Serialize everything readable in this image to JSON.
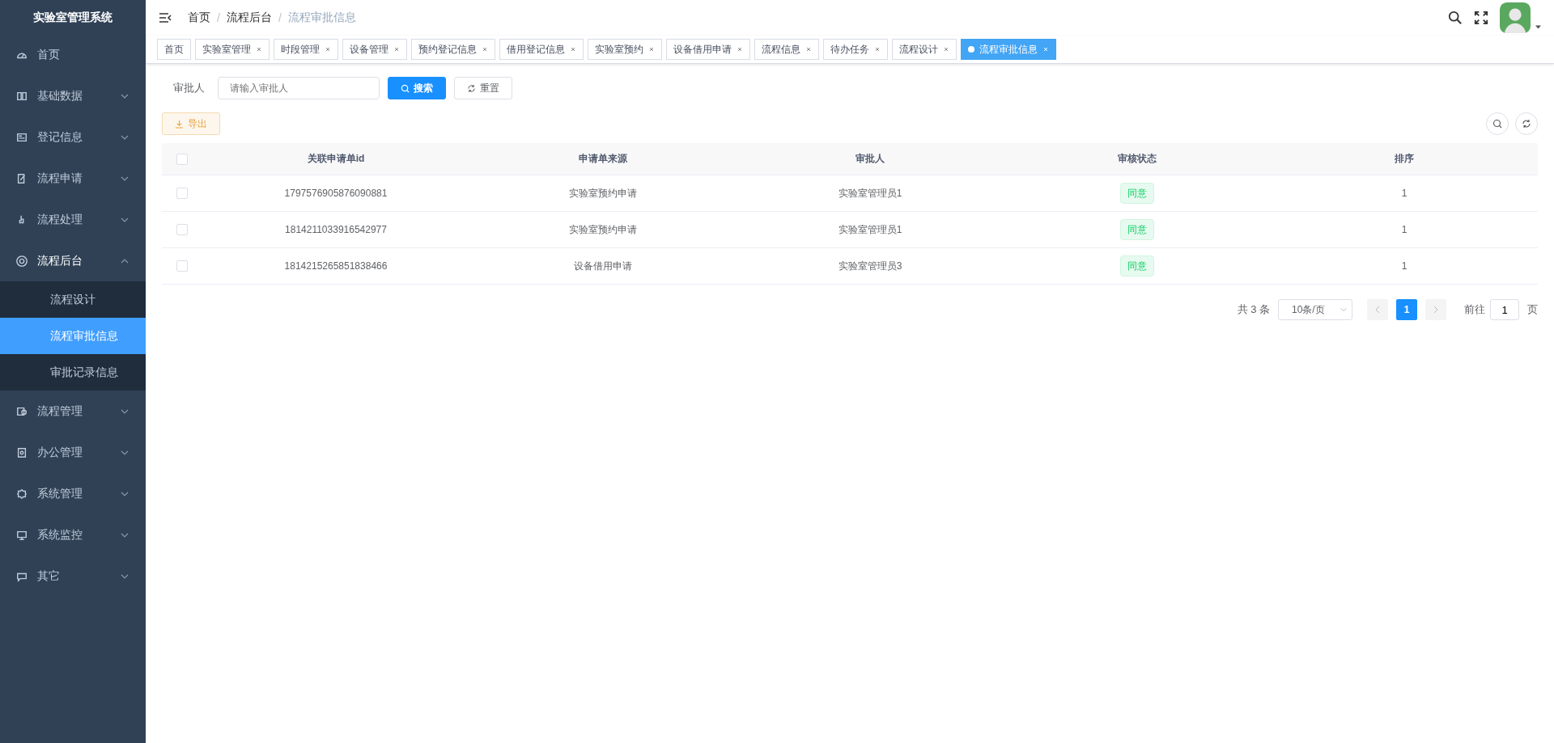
{
  "sidebar": {
    "title": "实验室管理系统",
    "items": [
      {
        "label": "首页"
      },
      {
        "label": "基础数据",
        "expanded": false
      },
      {
        "label": "登记信息",
        "expanded": false
      },
      {
        "label": "流程申请",
        "expanded": false
      },
      {
        "label": "流程处理",
        "expanded": false
      },
      {
        "label": "流程后台",
        "expanded": true,
        "children": [
          {
            "label": "流程设计",
            "selected": false
          },
          {
            "label": "流程审批信息",
            "selected": true
          },
          {
            "label": "审批记录信息",
            "selected": false
          }
        ]
      },
      {
        "label": "流程管理",
        "expanded": false
      },
      {
        "label": "办公管理",
        "expanded": false
      },
      {
        "label": "系统管理",
        "expanded": false
      },
      {
        "label": "系统监控",
        "expanded": false
      },
      {
        "label": "其它",
        "expanded": false
      }
    ]
  },
  "breadcrumb": [
    {
      "label": "首页",
      "current": false
    },
    {
      "separator": "/",
      "label": "流程后台",
      "current": false
    },
    {
      "separator": "/",
      "label": "流程审批信息",
      "current": true
    }
  ],
  "tags": [
    {
      "label": "首页",
      "selected": false,
      "closable": false
    },
    {
      "label": "实验室管理",
      "selected": false,
      "closable": true
    },
    {
      "label": "时段管理",
      "selected": false,
      "closable": true
    },
    {
      "label": "设备管理",
      "selected": false,
      "closable": true
    },
    {
      "label": "预约登记信息",
      "selected": false,
      "closable": true
    },
    {
      "label": "借用登记信息",
      "selected": false,
      "closable": true
    },
    {
      "label": "实验室预约",
      "selected": false,
      "closable": true
    },
    {
      "label": "设备借用申请",
      "selected": false,
      "closable": true
    },
    {
      "label": "流程信息",
      "selected": false,
      "closable": true
    },
    {
      "label": "待办任务",
      "selected": false,
      "closable": true
    },
    {
      "label": "流程设计",
      "selected": false,
      "closable": true
    },
    {
      "label": "流程审批信息",
      "selected": true,
      "closable": true
    }
  ],
  "filter": {
    "label": "审批人",
    "placeholder": "请输入审批人",
    "search_button": "搜索",
    "reset_button": "重置"
  },
  "export_button": "导出",
  "table": {
    "select_all_checked": false,
    "columns": [
      "关联申请单id",
      "申请单来源",
      "审批人",
      "审核状态",
      "排序"
    ],
    "rows": [
      {
        "checked": false,
        "cells": [
          "1797576905876090881",
          "实验室预约申请",
          "实验室管理员1",
          "同意",
          "1"
        ]
      },
      {
        "checked": false,
        "cells": [
          "1814211033916542977",
          "实验室预约申请",
          "实验室管理员1",
          "同意",
          "1"
        ]
      },
      {
        "checked": false,
        "cells": [
          "1814215265851838466",
          "设备借用申请",
          "实验室管理员3",
          "同意",
          "1"
        ]
      }
    ]
  },
  "pagination": {
    "total": "共 3 条",
    "page_size": "10条/页",
    "pages": [
      {
        "label": "1",
        "selected": true
      }
    ],
    "goto_label": "前往",
    "goto_value": "1",
    "goto_suffix": "页"
  }
}
